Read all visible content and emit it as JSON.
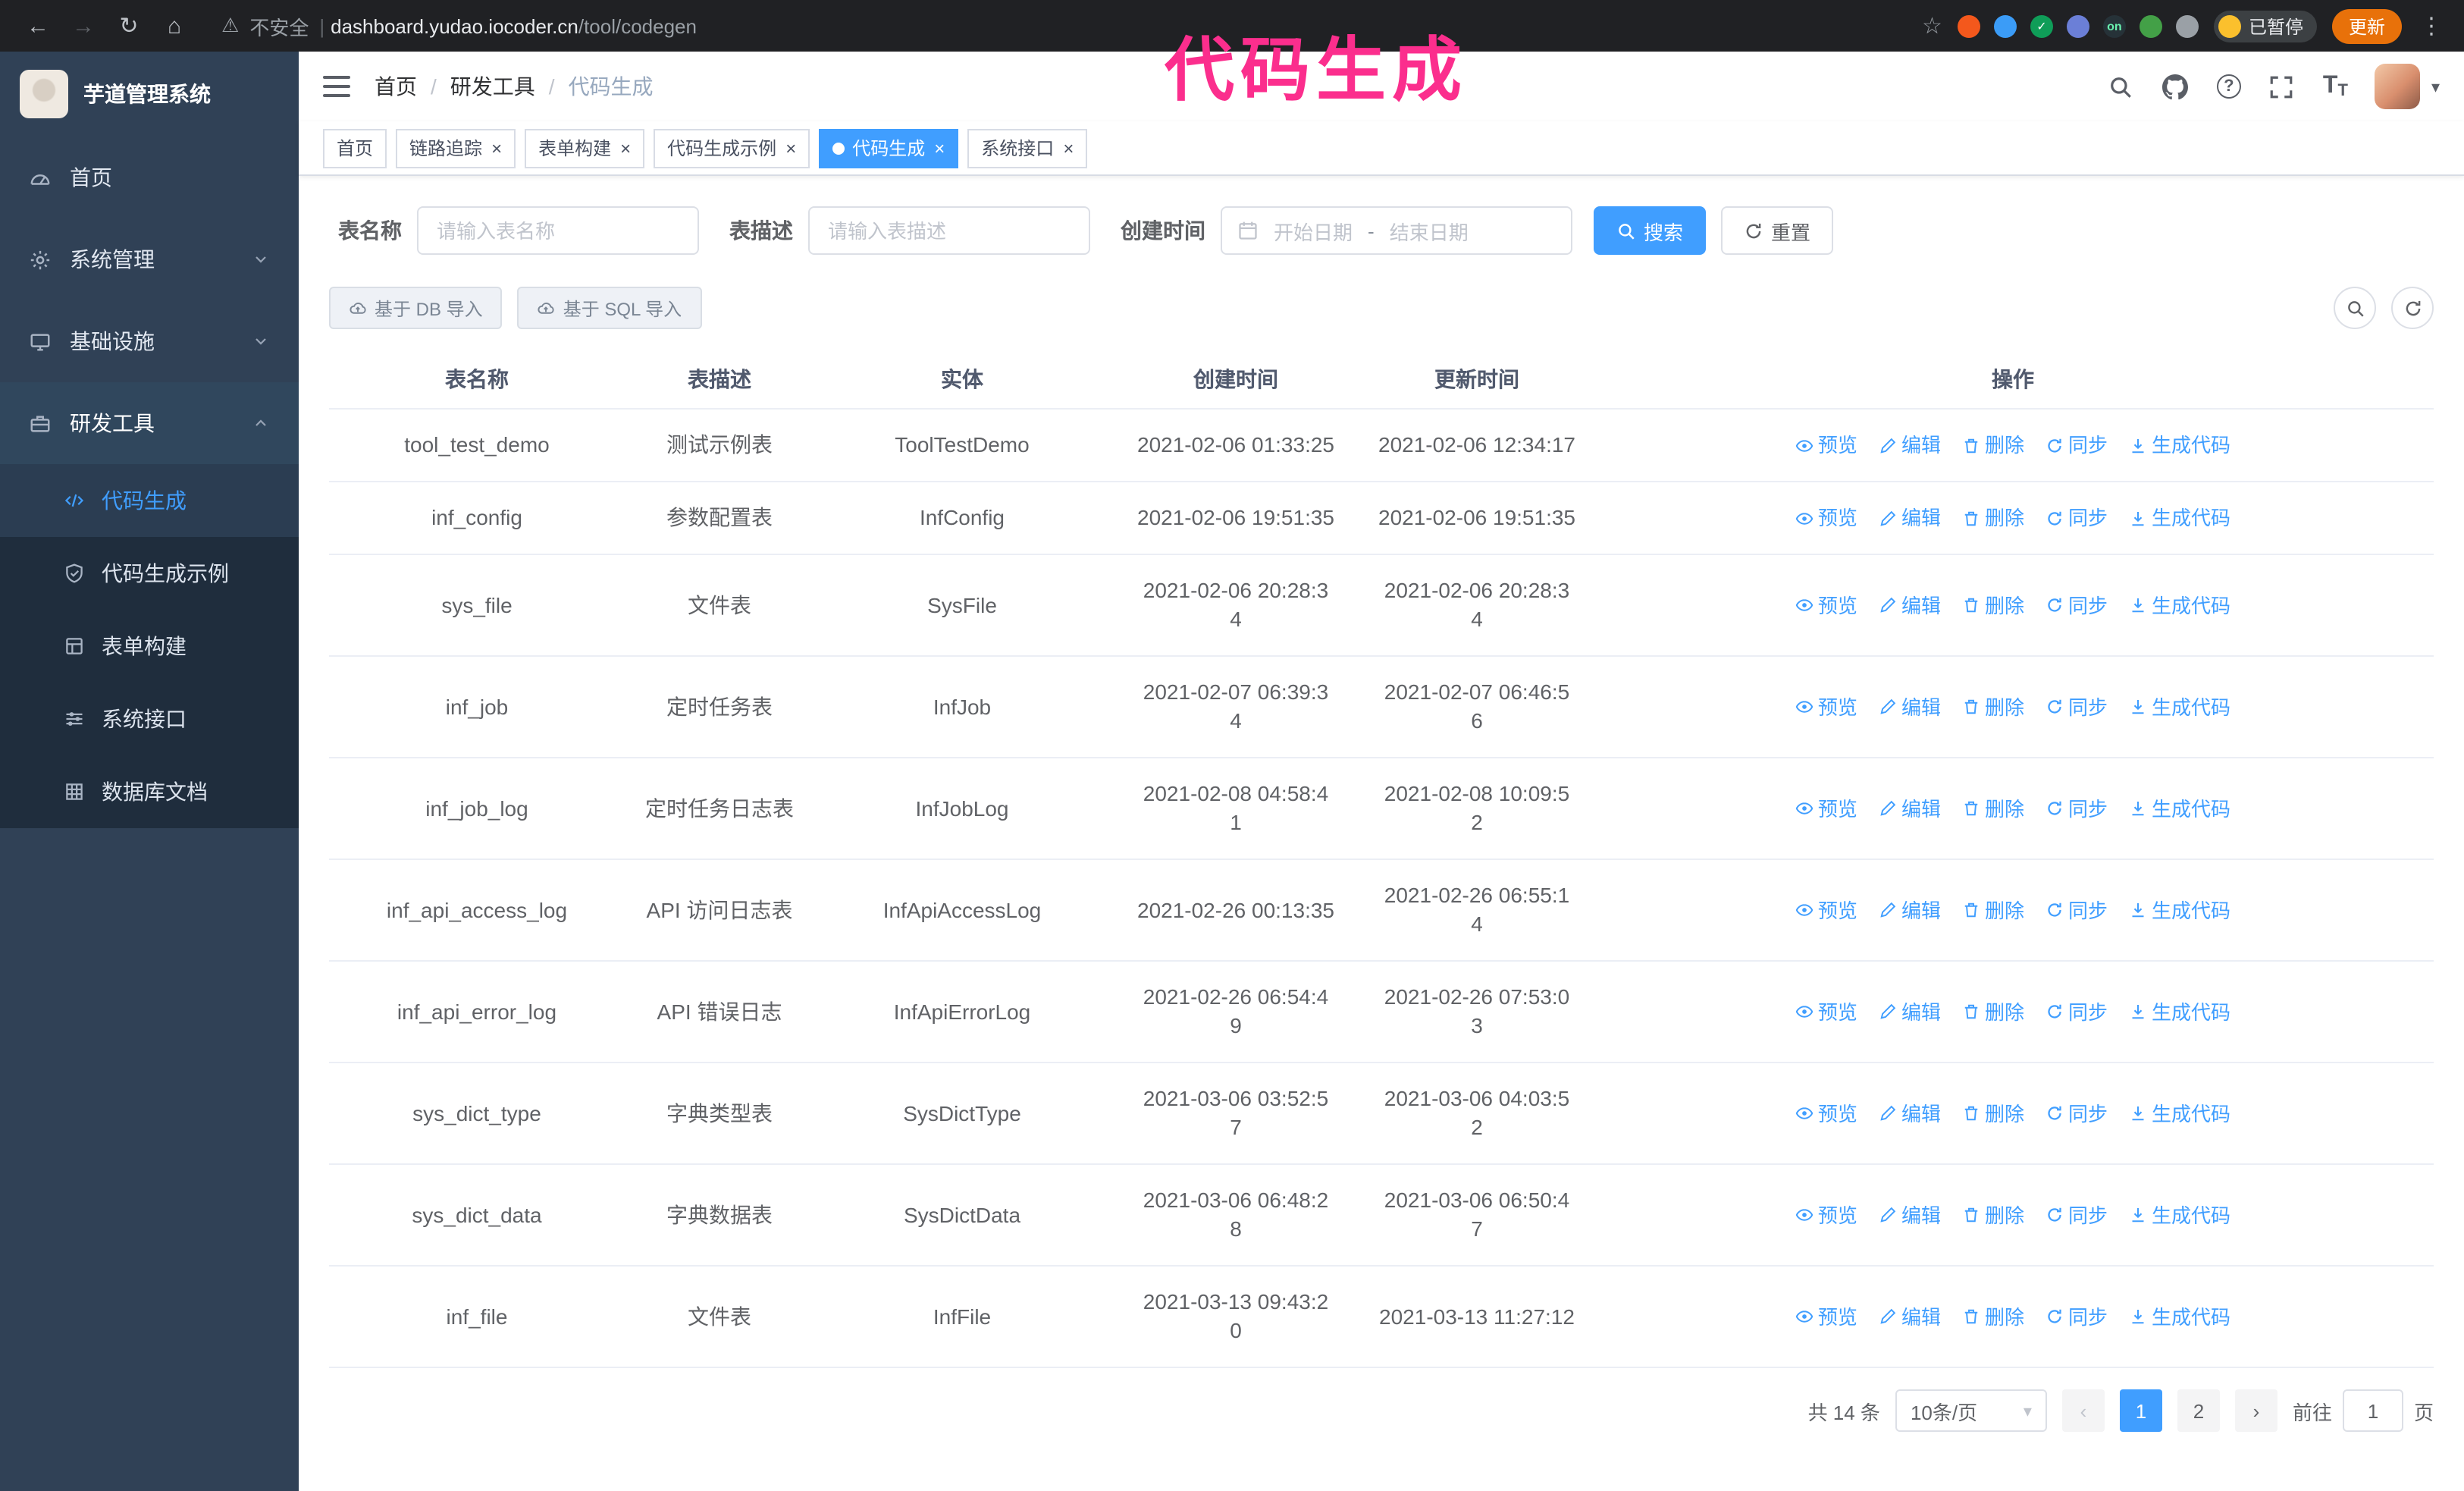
{
  "overlay": {
    "text": "代码生成",
    "color": "#fb2e8d"
  },
  "browser": {
    "security_label": "不安全",
    "url_host": "dashboard.yudao.iocoder.cn",
    "url_path": "/tool/codegen",
    "paused_badge": "已暂停",
    "update_button": "更新",
    "extensions": [
      {
        "name": "lighthouse-extension",
        "color": "#f4581c"
      },
      {
        "name": "drop-extension",
        "color": "#3b9cf7"
      },
      {
        "name": "check-extension",
        "color": "#0f9d58",
        "glyph": "✓"
      },
      {
        "name": "people-extension",
        "color": "#6b7fd7"
      },
      {
        "name": "on-extension",
        "color": "#263238",
        "glyph": "on",
        "glyph_color": "#69f0ae"
      },
      {
        "name": "leaf-extension",
        "color": "#43a047"
      },
      {
        "name": "puzzle-extension",
        "color": "#9aa0a6"
      }
    ]
  },
  "glyphs": {
    "back": "←",
    "forward": "→",
    "reload": "↻",
    "home": "⌂",
    "warning": "⚠",
    "divider": "|",
    "star": "☆",
    "kebab": "⋮",
    "caret": "▾",
    "crumb_sep": "/",
    "close": "×",
    "prev": "‹",
    "next": "›",
    "question": "?",
    "font_large": "T",
    "font_small": "T"
  },
  "sidebar": {
    "logo_title": "芋道管理系统",
    "items": [
      {
        "label": "首页"
      },
      {
        "label": "系统管理"
      },
      {
        "label": "基础设施"
      },
      {
        "label": "研发工具"
      }
    ],
    "subitems": [
      {
        "label": "代码生成"
      },
      {
        "label": "代码生成示例"
      },
      {
        "label": "表单构建"
      },
      {
        "label": "系统接口"
      },
      {
        "label": "数据库文档"
      }
    ]
  },
  "breadcrumb": {
    "items": [
      "首页",
      "研发工具",
      "代码生成"
    ]
  },
  "tabs": [
    {
      "label": "首页"
    },
    {
      "label": "链路追踪"
    },
    {
      "label": "表单构建"
    },
    {
      "label": "代码生成示例"
    },
    {
      "label": "代码生成"
    },
    {
      "label": "系统接口"
    }
  ],
  "filters": {
    "table_name_label": "表名称",
    "table_name_placeholder": "请输入表名称",
    "table_desc_label": "表描述",
    "table_desc_placeholder": "请输入表描述",
    "create_time_label": "创建时间",
    "date_start_placeholder": "开始日期",
    "date_separator": "-",
    "date_end_placeholder": "结束日期",
    "search_button": "搜索",
    "reset_button": "重置"
  },
  "toolbar": {
    "import_db_button": "基于 DB 导入",
    "import_sql_button": "基于 SQL 导入"
  },
  "table": {
    "columns": [
      "表名称",
      "表描述",
      "实体",
      "创建时间",
      "更新时间",
      "操作"
    ],
    "action_labels": [
      "预览",
      "编辑",
      "删除",
      "同步",
      "生成代码"
    ],
    "rows": [
      {
        "name": "tool_test_demo",
        "desc": "测试示例表",
        "entity": "ToolTestDemo",
        "created": "2021-02-06 01:33:25",
        "updated": "2021-02-06 12:34:17"
      },
      {
        "name": "inf_config",
        "desc": "参数配置表",
        "entity": "InfConfig",
        "created": "2021-02-06 19:51:35",
        "updated": "2021-02-06 19:51:35"
      },
      {
        "name": "sys_file",
        "desc": "文件表",
        "entity": "SysFile",
        "created": "2021-02-06 20:28:3\n4",
        "updated": "2021-02-06 20:28:3\n4"
      },
      {
        "name": "inf_job",
        "desc": "定时任务表",
        "entity": "InfJob",
        "created": "2021-02-07 06:39:3\n4",
        "updated": "2021-02-07 06:46:5\n6"
      },
      {
        "name": "inf_job_log",
        "desc": "定时任务日志表",
        "entity": "InfJobLog",
        "created": "2021-02-08 04:58:4\n1",
        "updated": "2021-02-08 10:09:5\n2"
      },
      {
        "name": "inf_api_access_log",
        "desc": "API 访问日志表",
        "entity": "InfApiAccessLog",
        "created": "2021-02-26 00:13:35",
        "updated": "2021-02-26 06:55:1\n4"
      },
      {
        "name": "inf_api_error_log",
        "desc": "API 错误日志",
        "entity": "InfApiErrorLog",
        "created": "2021-02-26 06:54:4\n9",
        "updated": "2021-02-26 07:53:0\n3"
      },
      {
        "name": "sys_dict_type",
        "desc": "字典类型表",
        "entity": "SysDictType",
        "created": "2021-03-06 03:52:5\n7",
        "updated": "2021-03-06 04:03:5\n2"
      },
      {
        "name": "sys_dict_data",
        "desc": "字典数据表",
        "entity": "SysDictData",
        "created": "2021-03-06 06:48:2\n8",
        "updated": "2021-03-06 06:50:4\n7"
      },
      {
        "name": "inf_file",
        "desc": "文件表",
        "entity": "InfFile",
        "created": "2021-03-13 09:43:2\n0",
        "updated": "2021-03-13 11:27:12"
      }
    ]
  },
  "pagination": {
    "total_text": "共 14 条",
    "page_size": "10条/页",
    "pages": [
      "1",
      "2"
    ],
    "goto_label": "前往",
    "goto_value": "1",
    "goto_unit": "页"
  }
}
